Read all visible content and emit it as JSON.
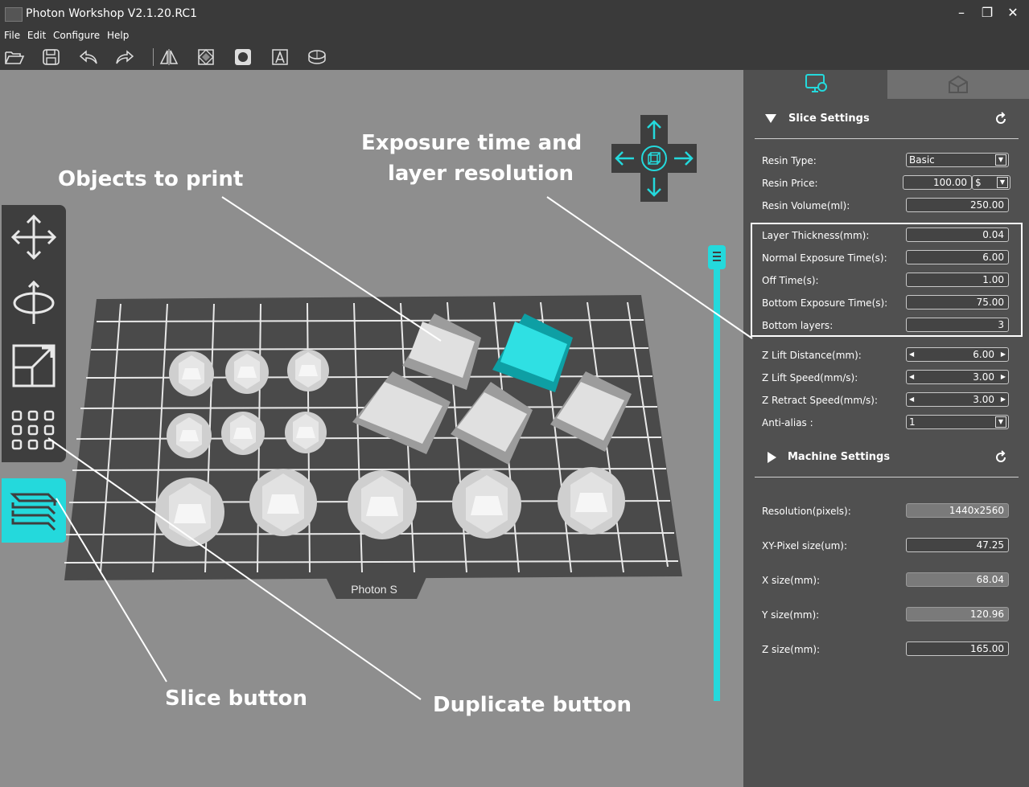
{
  "window": {
    "title": "Photon Workshop V2.1.20.RC1"
  },
  "menu": {
    "items": [
      "File",
      "Edit",
      "Configure",
      "Help"
    ]
  },
  "toolbar": {
    "icons": [
      "open-icon",
      "save-icon",
      "undo-icon",
      "redo-icon",
      "mirror-icon",
      "hollow-icon",
      "fill-icon",
      "text-icon",
      "platform-icon"
    ]
  },
  "build_plate": {
    "label": "Photon S"
  },
  "slice_settings": {
    "title": "Slice Settings",
    "resin_type_label": "Resin Type:",
    "resin_type_value": "Basic",
    "resin_price_label": "Resin Price:",
    "resin_price_value": "100.00",
    "resin_price_currency": "$",
    "resin_volume_label": "Resin Volume(ml):",
    "resin_volume_value": "250.00",
    "layer_thickness_label": "Layer Thickness(mm):",
    "layer_thickness_value": "0.04",
    "normal_exposure_label": "Normal Exposure Time(s):",
    "normal_exposure_value": "6.00",
    "off_time_label": "Off Time(s):",
    "off_time_value": "1.00",
    "bottom_exposure_label": "Bottom Exposure Time(s):",
    "bottom_exposure_value": "75.00",
    "bottom_layers_label": "Bottom layers:",
    "bottom_layers_value": "3",
    "z_lift_distance_label": "Z Lift Distance(mm):",
    "z_lift_distance_value": "6.00",
    "z_lift_speed_label": "Z Lift Speed(mm/s):",
    "z_lift_speed_value": "3.00",
    "z_retract_speed_label": "Z Retract Speed(mm/s):",
    "z_retract_speed_value": "3.00",
    "anti_alias_label": "Anti-alias :",
    "anti_alias_value": "1"
  },
  "machine_settings": {
    "title": "Machine Settings",
    "resolution_label": "Resolution(pixels):",
    "resolution_value": "1440x2560",
    "xy_pixel_label": "XY-Pixel size(um):",
    "xy_pixel_value": "47.25",
    "x_size_label": "X size(mm):",
    "x_size_value": "68.04",
    "y_size_label": "Y size(mm):",
    "y_size_value": "120.96",
    "z_size_label": "Z size(mm):",
    "z_size_value": "165.00"
  },
  "annotations": {
    "objects": "Objects to print",
    "exposure_line1": "Exposure time and",
    "exposure_line2": "layer resolution",
    "slice": "Slice button",
    "duplicate": "Duplicate button"
  },
  "colors": {
    "accent": "#24d9dc",
    "panel": "#505050",
    "chrome": "#3a3a3a",
    "viewport": "#8e8e8e",
    "plate": "#4a4a4a"
  }
}
